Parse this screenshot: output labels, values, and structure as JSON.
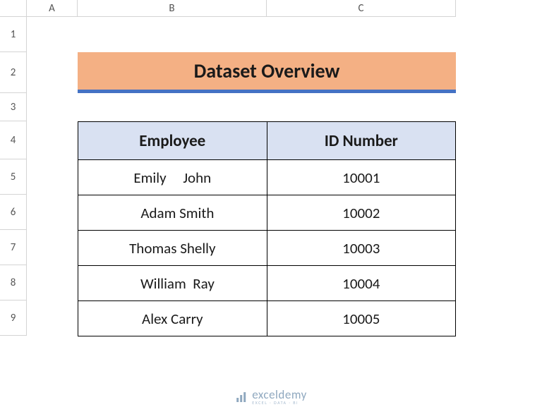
{
  "columns": {
    "a": "A",
    "b": "B",
    "c": "C"
  },
  "rows": {
    "r1": "1",
    "r2": "2",
    "r3": "3",
    "r4": "4",
    "r5": "5",
    "r6": "6",
    "r7": "7",
    "r8": "8",
    "r9": "9"
  },
  "title": "Dataset Overview",
  "table": {
    "headers": {
      "employee": "Employee",
      "id": "ID Number"
    },
    "rows": [
      {
        "employee": "Emily     John",
        "id": "10001"
      },
      {
        "employee": "   Adam Smith",
        "id": "10002"
      },
      {
        "employee": "Thomas Shelly",
        "id": "10003"
      },
      {
        "employee": "   William  Ray",
        "id": "10004"
      },
      {
        "employee": "Alex Carry",
        "id": "10005"
      }
    ]
  },
  "watermark": {
    "main": "exceldemy",
    "sub": "EXCEL · DATA · BI"
  }
}
